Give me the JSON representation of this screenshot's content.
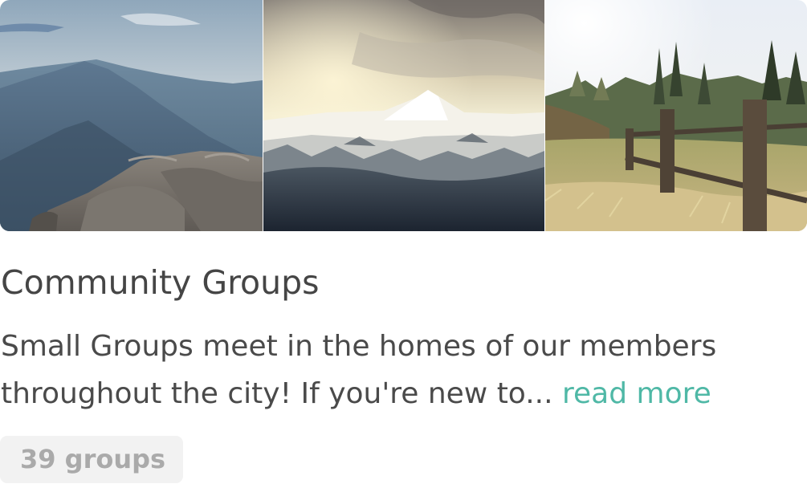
{
  "card": {
    "title": "Community Groups",
    "description": "Small Groups meet in the homes of our members throughout the city! If you're new to... ",
    "read_more_label": "read more",
    "group_count_label": "39 groups"
  },
  "colors": {
    "title_text": "#454545",
    "body_text": "#4a4a4a",
    "link_accent": "#4fb8a6",
    "badge_background": "#f2f2f2",
    "badge_text": "#aaaaaa"
  }
}
